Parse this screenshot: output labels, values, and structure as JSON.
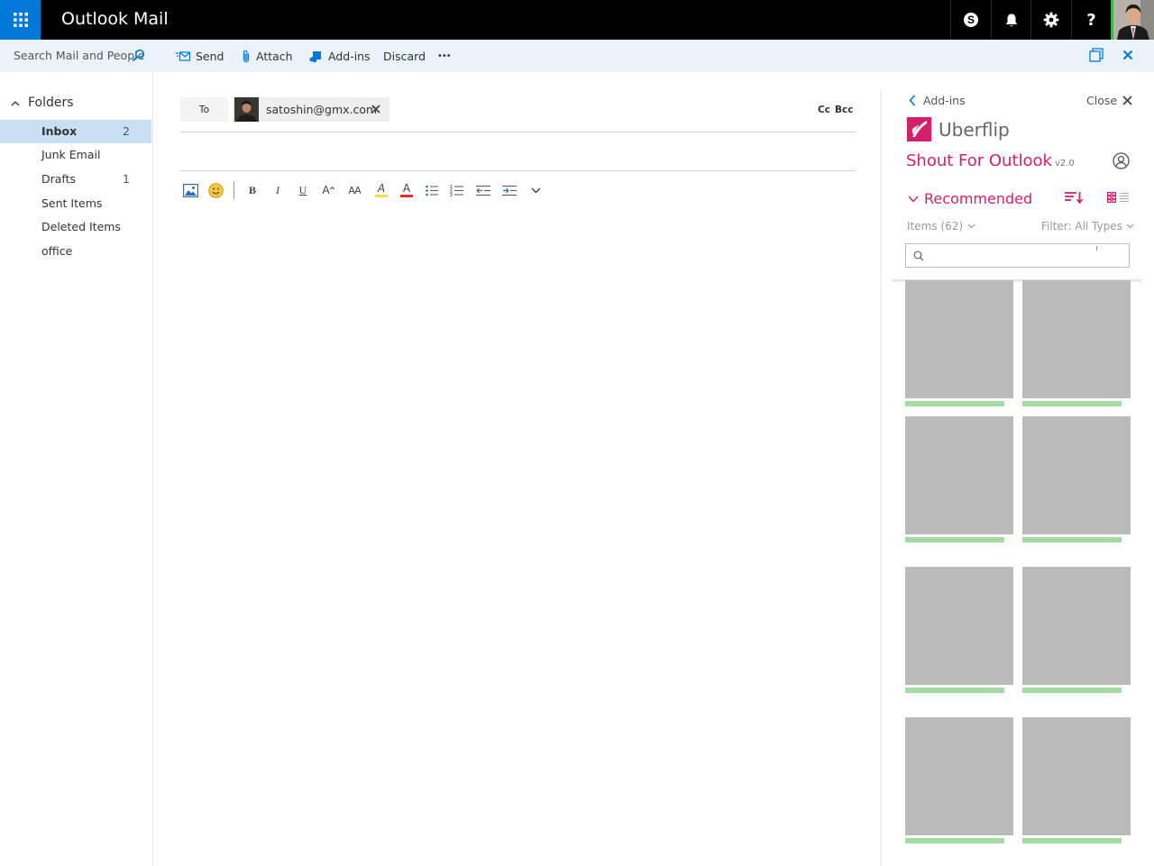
{
  "app": {
    "title": "Outlook Mail"
  },
  "topbar": {
    "icons": [
      "waffle-icon",
      "skype-icon",
      "bell-icon",
      "gear-icon",
      "help-icon"
    ],
    "help_label": "?"
  },
  "search": {
    "placeholder": "Search Mail and People"
  },
  "commands": {
    "send": "Send",
    "attach": "Attach",
    "addins": "Add-ins",
    "discard": "Discard",
    "more": "•••"
  },
  "folders": {
    "heading": "Folders",
    "items": [
      {
        "label": "Inbox",
        "count": "2",
        "selected": true
      },
      {
        "label": "Junk Email",
        "count": ""
      },
      {
        "label": "Drafts",
        "count": "1"
      },
      {
        "label": "Sent Items",
        "count": ""
      },
      {
        "label": "Deleted Items",
        "count": ""
      },
      {
        "label": "office",
        "count": ""
      }
    ]
  },
  "compose": {
    "to_label": "To",
    "recipient": "satoshin@gmx.com",
    "cc_label": "Cc",
    "bcc_label": "Bcc",
    "format_tools": [
      "insert-picture-icon",
      "emoji-icon",
      "bold-icon",
      "italic-icon",
      "underline-icon",
      "grow-font-icon",
      "font-size-icon",
      "highlight-icon",
      "font-color-icon",
      "bullets-icon",
      "numbering-icon",
      "decrease-indent-icon",
      "increase-indent-icon",
      "more-formatting-icon"
    ],
    "bold": "B",
    "italic": "I",
    "underline": "U",
    "grow_font": "A",
    "font_size": "AA",
    "highlight": "A",
    "font_color": "A"
  },
  "addin_pane": {
    "back_label": "Add-ins",
    "close_label": "Close",
    "brand": "Uberflip",
    "title": "Shout For Outlook",
    "version": "v2.0",
    "section": "Recommended",
    "items_label": "Items (62)",
    "filter_label": "Filter: All Types",
    "accent_color": "#d41f6b",
    "cards": [
      {
        "progress": 0.92
      },
      {
        "progress": 0.92
      },
      {
        "progress": 0.92
      },
      {
        "progress": 0.92
      },
      {
        "progress": 0.92
      },
      {
        "progress": 0.92
      },
      {
        "progress": 0.92
      },
      {
        "progress": 0.92
      }
    ]
  },
  "colors": {
    "brand_blue": "#0078d7",
    "selected_folder": "#c7e0f4",
    "command_bar": "#eaf3fb",
    "accent": "#d41f6b"
  }
}
